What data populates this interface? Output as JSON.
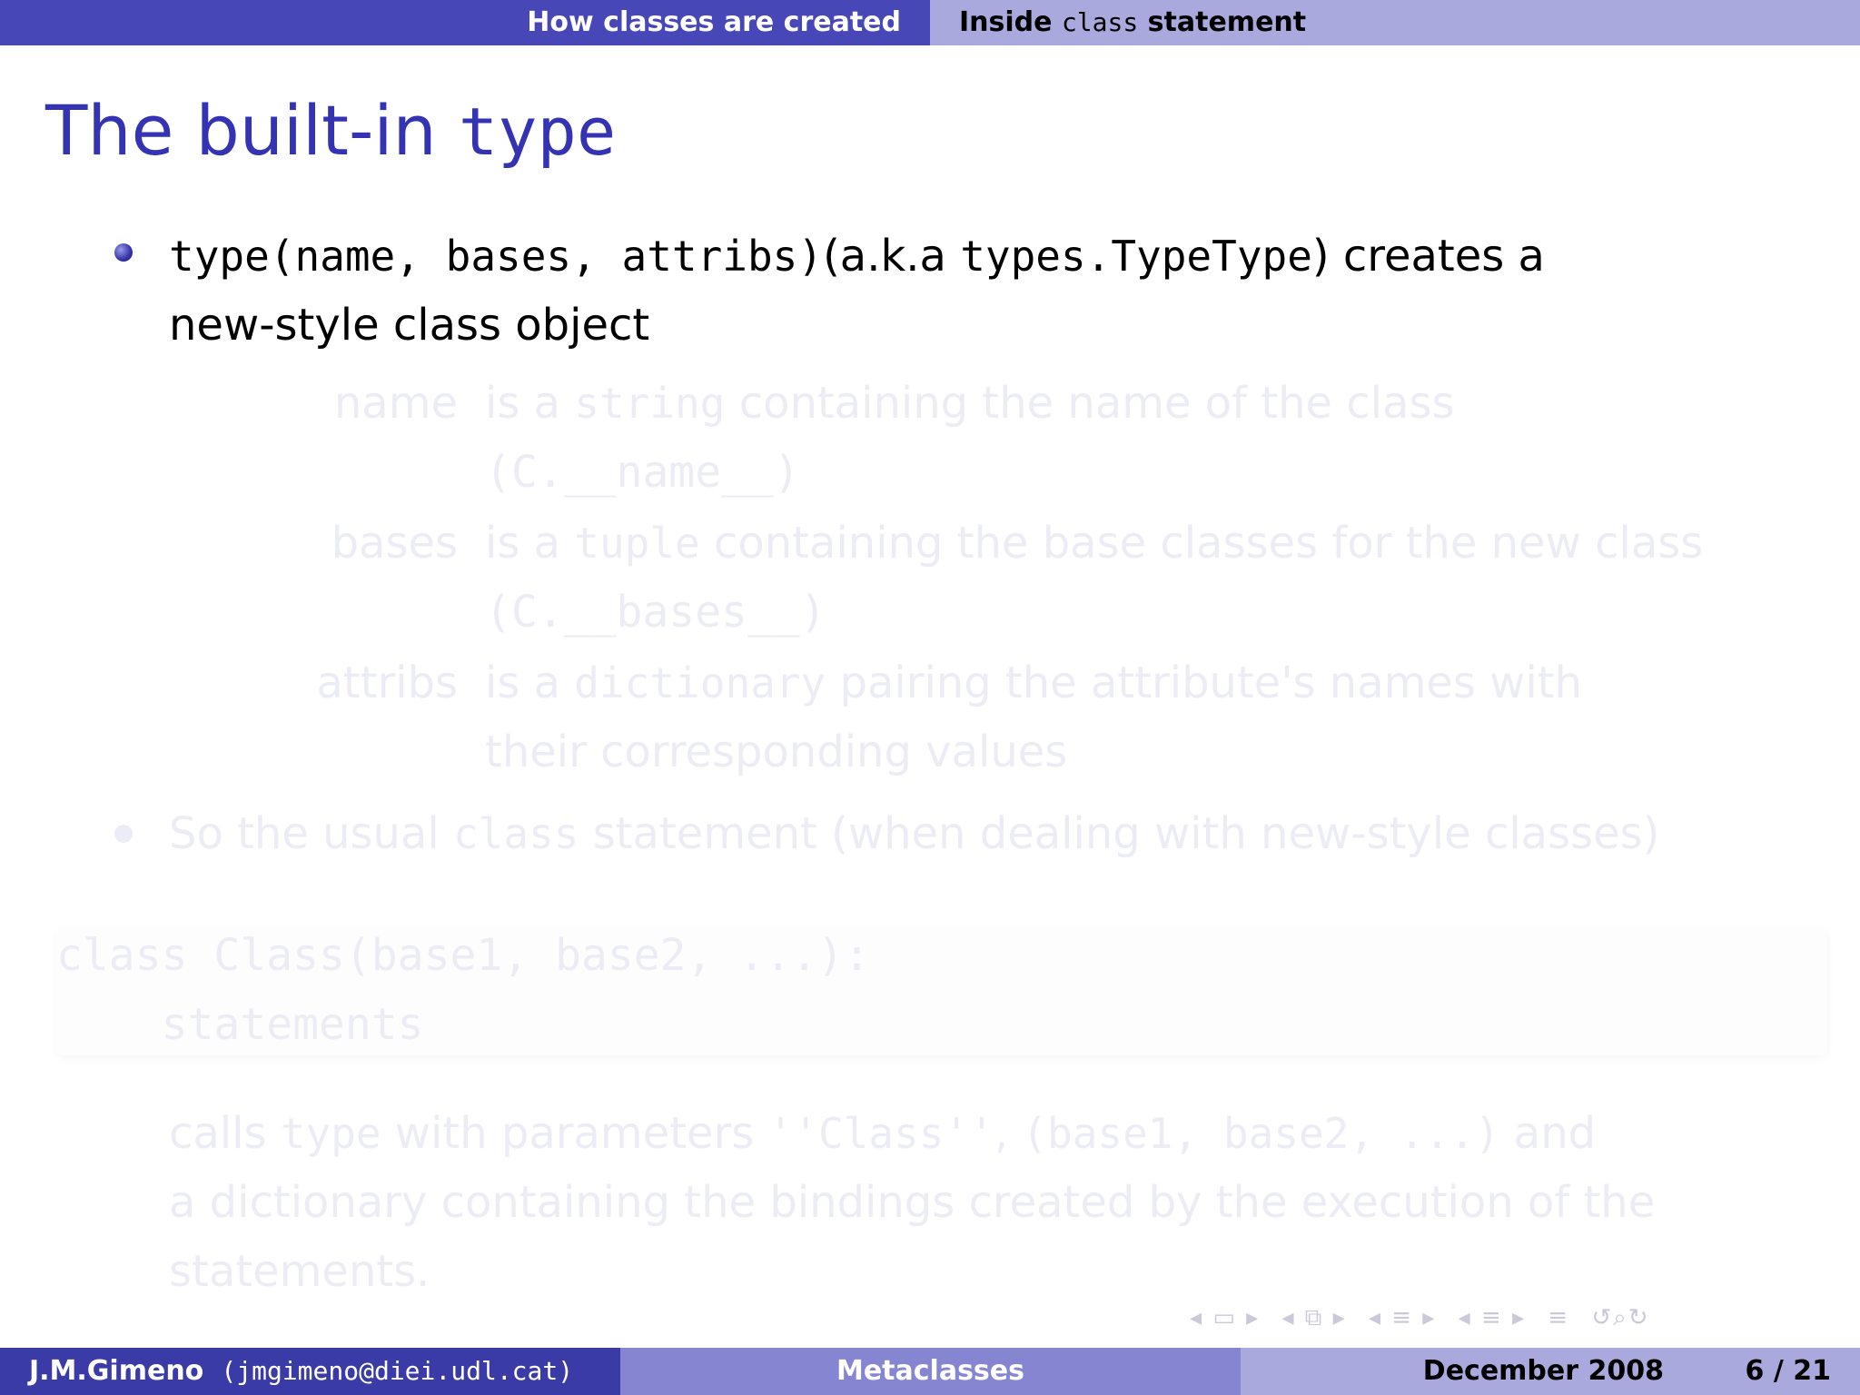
{
  "header": {
    "section_left": "How classes are created",
    "section_right_prefix": "Inside ",
    "section_right_code": "class",
    "section_right_suffix": " statement"
  },
  "frame": {
    "title_prefix": "The built-in ",
    "title_code": "type"
  },
  "bullets": [
    {
      "code1": "type(name, bases, attribs)",
      "text1": "(a.k.a ",
      "code2": "types.TypeType",
      "text2": ") creates a",
      "line2": "new-style class object"
    }
  ],
  "definitions": [
    {
      "term": "name",
      "line1_pre": "is a ",
      "line1_code": "string",
      "line1_post": " containing the name of the class",
      "line2": "(C.__name__)"
    },
    {
      "term": "bases",
      "line1_pre": "is a ",
      "line1_code": "tuple",
      "line1_post": " containing the base classes for the new class",
      "line2": "(C.__bases__)"
    },
    {
      "term": "attribs",
      "line1_pre": "is a ",
      "line1_code": "dictionary",
      "line1_post": " pairing the attribute's names with",
      "line2": "their corresponding values"
    }
  ],
  "bullet2": {
    "pre": "So the usual ",
    "code": "class",
    "post": " statement (when dealing with new-style classes)"
  },
  "code": {
    "line1": "class Class(base1, base2, ...):",
    "line2": "    statements"
  },
  "explanation": {
    "line1_pre": "calls ",
    "line1_code1": "type",
    "line1_mid": " with parameters ",
    "line1_code2": "''Class''",
    "line1_sep": ", ",
    "line1_code3": "(base1, base2, ...)",
    "line1_post": " and",
    "line2": "a dictionary containing the bindings created by the execution of the",
    "line3": "statements."
  },
  "nav_icons": [
    "frame-nav-icon",
    "subsection-nav-icon",
    "section-nav-icon",
    "document-nav-icon",
    "back-forward-icon",
    "search-icon"
  ],
  "footer": {
    "author": "J.M.Gimeno",
    "email": "(jmgimeno@diei.udl.cat)",
    "title": "Metaclasses",
    "date": "December 2008",
    "page": "6 / 21"
  },
  "colors": {
    "title": "#3333b3",
    "header_dark": "#4747b8",
    "header_light": "#a9a9de",
    "footer_mid": "#8585d2",
    "faded_text": "#ececf4"
  }
}
